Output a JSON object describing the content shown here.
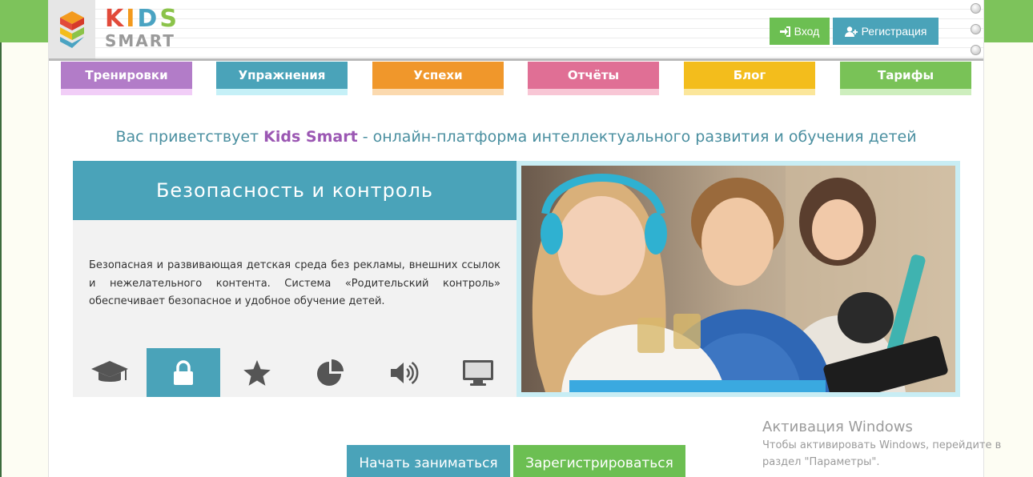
{
  "logo": {
    "kids_letters": [
      "K",
      "I",
      "D",
      "S"
    ],
    "smart": "SMART"
  },
  "auth": {
    "login_label": "Вход",
    "register_label": "Регистрация"
  },
  "nav": {
    "tabs": [
      {
        "label": "Тренировки",
        "color": "#b27cc8",
        "underline": "#f1cdf7"
      },
      {
        "label": "Упражнения",
        "color": "#4aa3b9",
        "underline": "#c5f0f7"
      },
      {
        "label": "Успехи",
        "color": "#f0972b",
        "underline": "#fbd9ae"
      },
      {
        "label": "Отчёты",
        "color": "#e06f95",
        "underline": "#f8c6d5"
      },
      {
        "label": "Блог",
        "color": "#f3bd1c",
        "underline": "#fbe69a"
      },
      {
        "label": "Тарифы",
        "color": "#79c257",
        "underline": "#cdeebd"
      }
    ]
  },
  "welcome": {
    "prefix": "Вас приветствует ",
    "brand": "Kids Smart",
    "suffix": " - онлайн-платформа интеллектуального развития и обучения детей"
  },
  "feature": {
    "title": "Безопасность и контроль",
    "description": "Безопасная и развивающая детская среда без рекламы, внешних ссылок и нежелательного контента. Система «Родительский контроль» обеспечивает безопасное и удобное обучение детей.",
    "icons": [
      "graduation-cap-icon",
      "lock-icon",
      "star-icon",
      "pie-chart-icon",
      "speaker-icon",
      "monitor-icon"
    ],
    "active_index": 1
  },
  "cta": {
    "start_label": "Начать заниматься",
    "signup_label": "Зарегистрироваться"
  },
  "watermark": {
    "title": "Активация Windows",
    "line1": "Чтобы активировать Windows, перейдите в",
    "line2": "раздел \"Параметры\"."
  },
  "colors": {
    "accent_blue": "#4aa3b9",
    "accent_green": "#6cbf52",
    "brand_purple": "#9b57b3"
  }
}
